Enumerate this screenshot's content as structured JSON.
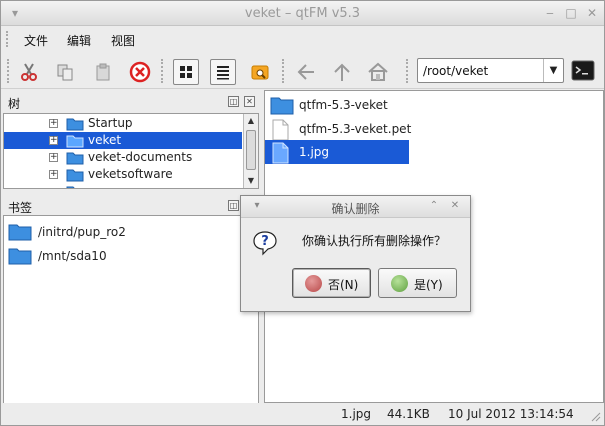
{
  "window": {
    "title": "veket – qtFM v5.3"
  },
  "menu": {
    "file": "文件",
    "edit": "编辑",
    "view": "视图"
  },
  "toolbar": {
    "path": "/root/veket"
  },
  "tree": {
    "title": "树",
    "items": [
      {
        "label": "Startup"
      },
      {
        "label": "veket"
      },
      {
        "label": "veket-documents"
      },
      {
        "label": "veketsoftware"
      }
    ]
  },
  "bookmarks": {
    "title": "书签",
    "items": [
      {
        "label": "/initrd/pup_ro2"
      },
      {
        "label": "/mnt/sda10"
      }
    ]
  },
  "files": {
    "items": [
      {
        "label": "qtfm-5.3-veket",
        "icon": "folder-icon"
      },
      {
        "label": "qtfm-5.3-veket.pet",
        "icon": "file-icon"
      },
      {
        "label": "1.jpg",
        "icon": "file-icon"
      }
    ]
  },
  "status": {
    "name": "1.jpg",
    "size": "44.1KB",
    "date": "10 Jul 2012 13:14:54"
  },
  "dialog": {
    "title": "确认删除",
    "message": "你确认执行所有删除操作？",
    "no_label": "否(N)",
    "yes_label": "是(Y)"
  },
  "colors": {
    "selection": "#1a5ad6",
    "no_ball": "#b84848",
    "yes_ball": "#5fa040"
  }
}
